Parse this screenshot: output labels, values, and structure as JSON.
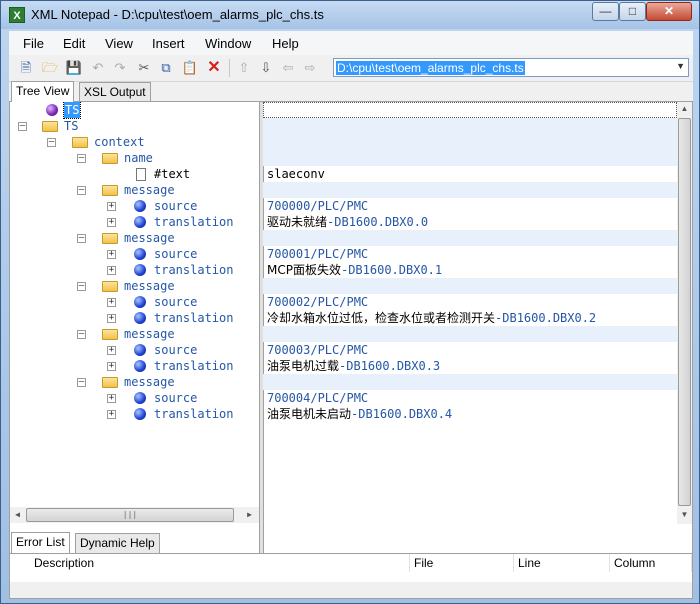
{
  "window": {
    "title": "XML Notepad - D:\\cpu\\test\\oem_alarms_plc_chs.ts",
    "app_icon": "X"
  },
  "menu": [
    "File",
    "Edit",
    "View",
    "Insert",
    "Window",
    "Help"
  ],
  "toolbar": {
    "icons": [
      "new-file-icon",
      "open-folder-icon",
      "save-icon",
      "undo-icon",
      "redo-icon",
      "cut-icon",
      "copy-icon",
      "paste-icon",
      "delete-icon",
      "nudge-up-icon",
      "nudge-down-icon",
      "nudge-left-icon",
      "nudge-right-icon"
    ],
    "path": "D:\\cpu\\test\\oem_alarms_plc_chs.ts"
  },
  "tabs": [
    "Tree View",
    "XSL Output"
  ],
  "tree": [
    {
      "label": "TS",
      "kind": "pi"
    },
    {
      "label": "TS",
      "kind": "folder"
    },
    {
      "label": "context",
      "kind": "folder"
    },
    {
      "label": "name",
      "kind": "folder"
    },
    {
      "label": "#text",
      "kind": "text"
    },
    {
      "label": "message",
      "kind": "folder"
    },
    {
      "label": "source",
      "kind": "element"
    },
    {
      "label": "translation",
      "kind": "element"
    },
    {
      "label": "message",
      "kind": "folder"
    },
    {
      "label": "source",
      "kind": "element"
    },
    {
      "label": "translation",
      "kind": "element"
    },
    {
      "label": "message",
      "kind": "folder"
    },
    {
      "label": "source",
      "kind": "element"
    },
    {
      "label": "translation",
      "kind": "element"
    },
    {
      "label": "message",
      "kind": "folder"
    },
    {
      "label": "source",
      "kind": "element"
    },
    {
      "label": "translation",
      "kind": "element"
    },
    {
      "label": "message",
      "kind": "folder"
    },
    {
      "label": "source",
      "kind": "element"
    },
    {
      "label": "translation",
      "kind": "element"
    }
  ],
  "values": {
    "name_text": "slaeconv",
    "messages": [
      {
        "source": "700000/PLC/PMC",
        "trans_cn": "驱动未就绪",
        "trans_code": "-DB1600.DBX0.0"
      },
      {
        "source": "700001/PLC/PMC",
        "trans_cn": "MCP面板失效",
        "trans_code": "-DB1600.DBX0.1"
      },
      {
        "source": "700002/PLC/PMC",
        "trans_cn": "冷却水箱水位过低，检查水位或者检测开关",
        "trans_code": "-DB1600.DBX0.2"
      },
      {
        "source": "700003/PLC/PMC",
        "trans_cn": "油泵电机过载",
        "trans_code": "-DB1600.DBX0.3"
      },
      {
        "source": "700004/PLC/PMC",
        "trans_cn": "油泵电机未启动",
        "trans_code": "-DB1600.DBX0.4"
      }
    ]
  },
  "bottom_tabs": [
    "Error List",
    "Dynamic Help"
  ],
  "error_columns": [
    "Description",
    "File",
    "Line",
    "Column"
  ]
}
